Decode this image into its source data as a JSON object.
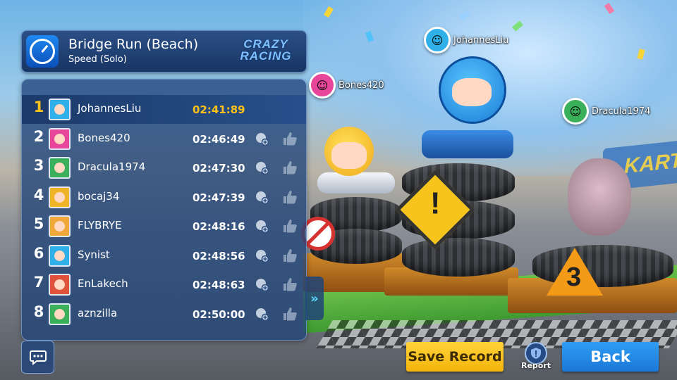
{
  "header": {
    "track_name": "Bridge Run (Beach)",
    "mode": "Speed (Solo)",
    "logo_line1": "CRAZY",
    "logo_line2": "RACING"
  },
  "results": [
    {
      "rank": "1",
      "name": "JohannesLiu",
      "time": "02:41:89",
      "avatar_color": "#2fb0e8"
    },
    {
      "rank": "2",
      "name": "Bones420",
      "time": "02:46:49",
      "avatar_color": "#e8469a"
    },
    {
      "rank": "3",
      "name": "Dracula1974",
      "time": "02:47:30",
      "avatar_color": "#3bb05a"
    },
    {
      "rank": "4",
      "name": "bocaj34",
      "time": "02:47:39",
      "avatar_color": "#f0b429"
    },
    {
      "rank": "5",
      "name": "FLYBRYE",
      "time": "02:48:16",
      "avatar_color": "#f0a83a"
    },
    {
      "rank": "6",
      "name": "Synist",
      "time": "02:48:56",
      "avatar_color": "#2fb0e8"
    },
    {
      "rank": "7",
      "name": "EnLakech",
      "time": "02:48:63",
      "avatar_color": "#e0523a"
    },
    {
      "rank": "8",
      "name": "aznzilla",
      "time": "02:50:00",
      "avatar_color": "#3bb05a"
    }
  ],
  "podium_tags": {
    "first": "JohannesLiu",
    "second": "Bones420",
    "third": "Dracula1974"
  },
  "actions": {
    "save_record": "Save Record",
    "report": "Report",
    "back": "Back"
  },
  "colors": {
    "winner_accent": "#ffc21a",
    "save_button": "#f3b40b",
    "back_button": "#1b78d6"
  }
}
